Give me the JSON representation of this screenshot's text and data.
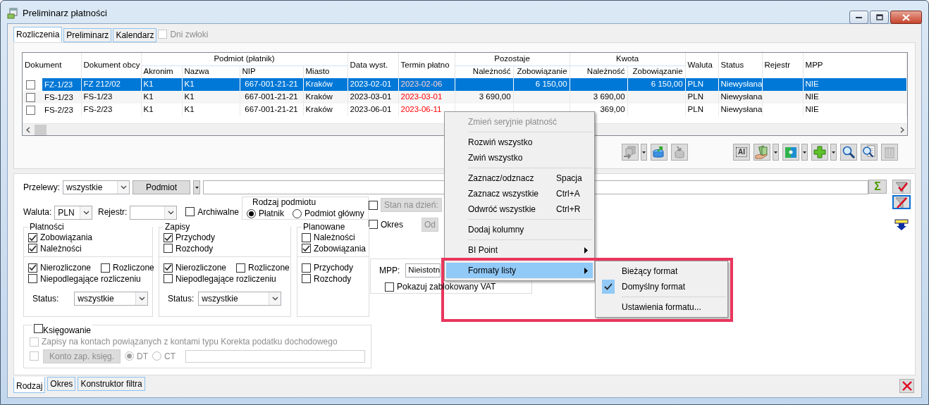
{
  "window": {
    "title": "Preliminarz płatności"
  },
  "tabs": [
    {
      "label": "Rozliczenia",
      "selected": true
    },
    {
      "label": "Preliminarz",
      "selected": false
    },
    {
      "label": "Kalendarz",
      "selected": false
    }
  ],
  "delay_days": {
    "label": "Dni zwłoki",
    "checked": false,
    "disabled": true
  },
  "table": {
    "columns": [
      {
        "label": "Dokument",
        "kind": "text"
      },
      {
        "label": "Dokument obcy",
        "kind": "text"
      },
      {
        "group": "Podmiot (płatnik)",
        "colspan": 4,
        "children": [
          {
            "label": "Akronim",
            "kind": "text"
          },
          {
            "label": "Nazwa",
            "kind": "text"
          },
          {
            "label": "NIP",
            "kind": "center"
          },
          {
            "label": "Miasto",
            "kind": "text"
          }
        ]
      },
      {
        "label": "Data wyst.",
        "kind": "text"
      },
      {
        "label": "Termin płatno",
        "kind": "due"
      },
      {
        "group": "Pozostaje",
        "colspan": 2,
        "children": [
          {
            "label": "Należność",
            "kind": "number"
          },
          {
            "label": "Zobowiązanie",
            "kind": "number"
          }
        ]
      },
      {
        "group": "Kwota",
        "colspan": 2,
        "children": [
          {
            "label": "Należność",
            "kind": "number"
          },
          {
            "label": "Zobowiązanie",
            "kind": "number"
          }
        ]
      },
      {
        "label": "Waluta",
        "kind": "text"
      },
      {
        "label": "Status",
        "kind": "text"
      },
      {
        "label": "Rejestr",
        "kind": "text"
      },
      {
        "label": "MPP",
        "kind": "text"
      }
    ],
    "rows": [
      {
        "checked": false,
        "selected": true,
        "cells": [
          "FZ-1/23",
          "FZ 212/02",
          "K1",
          "K1",
          "667-001-21-21",
          "Kraków",
          "2023-02-01",
          "2023-02-06",
          null,
          "6 150,00",
          null,
          "6 150,00",
          "PLN",
          "Niewysłana",
          null,
          "NIE"
        ]
      },
      {
        "checked": false,
        "selected": false,
        "cells": [
          "FS-1/23",
          "FS-1/23",
          "K1",
          "K1",
          "667-001-21-21",
          "Kraków",
          "2023-03-01",
          "2023-03-01",
          "3 690,00",
          null,
          "3 690,00",
          null,
          "PLN",
          "Niewysłana",
          null,
          "NIE"
        ]
      },
      {
        "checked": false,
        "selected": false,
        "cells": [
          "FS-2/23",
          "FS-2/23",
          "K1",
          "K1",
          "667-001-21-21",
          "Kraków",
          "2023-06-01",
          "2023-06-11",
          null,
          null,
          "369,00",
          null,
          "PLN",
          "Niewysłana",
          null,
          "NIE"
        ]
      }
    ]
  },
  "toolbar_groups": [
    [
      {
        "kind": "cube-arrow",
        "disabled": true,
        "dropdown": true
      },
      {
        "kind": "export",
        "disabled": false,
        "dropdown": false
      },
      {
        "kind": "import",
        "disabled": true,
        "dropdown": false
      }
    ],
    [
      {
        "kind": "ai",
        "label": "AI",
        "disabled": false,
        "dropdown": false
      },
      {
        "kind": "money",
        "disabled": false,
        "dropdown": true
      },
      {
        "kind": "puzzle",
        "disabled": false,
        "dropdown": true
      },
      {
        "kind": "plus",
        "disabled": false,
        "dropdown": true
      },
      {
        "kind": "search",
        "disabled": false,
        "dropdown": false
      },
      {
        "kind": "doc-search",
        "disabled": false,
        "dropdown": false
      },
      {
        "kind": "trash",
        "disabled": true,
        "dropdown": false
      }
    ]
  ],
  "filters": {
    "transfers": {
      "label": "Przelewy:",
      "value": "wszystkie"
    },
    "subject_button": "Podmiot",
    "currency": {
      "label": "Waluta:",
      "value": "PLN"
    },
    "register": {
      "label": "Rejestr:"
    },
    "archival": {
      "label": "Archiwalne",
      "checked": false
    },
    "subject_kind": {
      "title": "Rodzaj podmiotu",
      "options": [
        {
          "label": "Płatnik",
          "selected": true
        },
        {
          "label": "Podmiot główny",
          "selected": false
        }
      ]
    },
    "as_of": {
      "label": "Stan na dzień:",
      "checked": false
    },
    "period": {
      "label": "Okres",
      "checked": false,
      "from": "Od"
    },
    "groups": [
      {
        "title": "Płatności",
        "top": [
          {
            "label": "Zobowiązania",
            "checked": true
          },
          {
            "label": "Należności",
            "checked": true
          }
        ],
        "bottom": [
          {
            "label": "Nierozliczone",
            "checked": true
          },
          {
            "label": "Rozliczone",
            "checked": false
          },
          {
            "label": "Niepodlegające rozliczeniu",
            "checked": false
          }
        ],
        "status": {
          "label": "Status:",
          "value": "wszystkie"
        }
      },
      {
        "title": "Zapisy",
        "top": [
          {
            "label": "Przychody",
            "checked": true
          },
          {
            "label": "Rozchody",
            "checked": false
          }
        ],
        "bottom": [
          {
            "label": "Nierozliczone",
            "checked": true
          },
          {
            "label": "Rozliczone",
            "checked": false
          },
          {
            "label": "Niepodlegające rozliczeniu",
            "checked": false
          }
        ],
        "status": {
          "label": "Status:",
          "value": "wszystkie"
        }
      },
      {
        "title": "Planowane",
        "top": [
          {
            "label": "Należności",
            "checked": false
          },
          {
            "label": "Zobowiązania",
            "checked": true
          }
        ],
        "bottom": [
          {
            "label": "Przychody",
            "checked": false
          },
          {
            "label": "Rozchody",
            "checked": false
          }
        ]
      }
    ],
    "mpp": {
      "label": "MPP:",
      "value": "Nieistotn",
      "blocked_vat": {
        "label": "Pokazuj zablokowany VAT",
        "checked": false
      }
    },
    "posting": {
      "label": "Księgowanie",
      "checked": false,
      "correction": {
        "label": "Zapisy na kontach powiązanych z kontami typu Korekta podatku dochodowego",
        "checked": false
      },
      "account": {
        "checked": false,
        "button": "Konto zap. księg."
      },
      "sides": [
        {
          "label": "DT",
          "selected": true
        },
        {
          "label": "CT",
          "selected": false
        }
      ]
    }
  },
  "side_buttons": [
    {
      "kind": "sum",
      "label": "Σ",
      "focused": false
    },
    {
      "kind": "apply-filter",
      "focused": false
    },
    {
      "kind": "clear-filter",
      "focused": true
    },
    {
      "kind": "move-down",
      "focused": false
    }
  ],
  "bottom_tabs": [
    {
      "label": "Rodzaj",
      "selected": true
    },
    {
      "label": "Okres",
      "selected": false
    },
    {
      "label": "Konstruktor filtra",
      "selected": false
    }
  ],
  "context_menu": {
    "items": [
      {
        "kind": "item",
        "label": "Zmień seryjnie płatność",
        "disabled": true,
        "selected": false
      },
      {
        "kind": "separator"
      },
      {
        "kind": "item",
        "label": "Rozwiń wszystko",
        "disabled": false,
        "selected": false
      },
      {
        "kind": "item",
        "label": "Zwiń wszystko",
        "disabled": false,
        "selected": false
      },
      {
        "kind": "separator"
      },
      {
        "kind": "item",
        "label": "Zaznacz/odznacz",
        "shortcut": "Spacja",
        "disabled": false,
        "selected": false
      },
      {
        "kind": "item",
        "label": "Zaznacz wszystkie",
        "shortcut": "Ctrl+A",
        "disabled": false,
        "selected": false
      },
      {
        "kind": "item",
        "label": "Odwróć wszystkie",
        "shortcut": "Ctrl+R",
        "disabled": false,
        "selected": false
      },
      {
        "kind": "separator"
      },
      {
        "kind": "item",
        "label": "Dodaj kolumny",
        "disabled": false,
        "selected": false
      },
      {
        "kind": "separator"
      },
      {
        "kind": "submenu",
        "label": "BI Point",
        "disabled": false,
        "selected": false
      },
      {
        "kind": "separator"
      },
      {
        "kind": "submenu",
        "label": "Formaty listy",
        "disabled": false,
        "selected": true
      }
    ]
  },
  "submenu": {
    "items": [
      {
        "kind": "item",
        "label": "Bieżący format",
        "checked": false
      },
      {
        "kind": "item",
        "label": "Domyślny format",
        "checked": true
      },
      {
        "kind": "separator"
      },
      {
        "kind": "item",
        "label": "Ustawienia formatu...",
        "checked": false
      }
    ]
  },
  "highlight_frame": true
}
